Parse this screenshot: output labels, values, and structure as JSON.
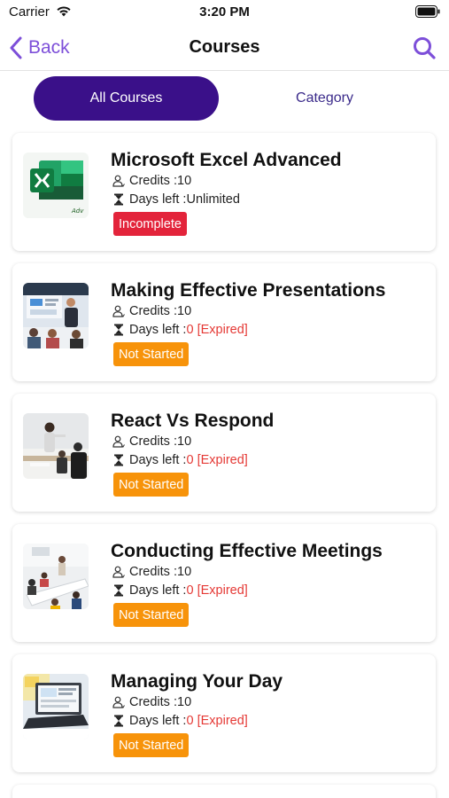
{
  "status_bar": {
    "carrier": "Carrier",
    "time": "3:20 PM"
  },
  "nav": {
    "back_label": "Back",
    "title": "Courses"
  },
  "tabs": {
    "all_courses": "All Courses",
    "category": "Category"
  },
  "labels": {
    "credits": "Credits : ",
    "days_left_unlimited": "Days left :",
    "days_left": "Days left : "
  },
  "colors": {
    "accent": "#7d4fd9",
    "tab_active": "#3a1089",
    "incomplete": "#e3243b",
    "not_started": "#f7930a",
    "expired": "#e53935"
  },
  "courses": [
    {
      "title": "Microsoft Excel Advanced",
      "credits": "10",
      "days_value": "Unlimited",
      "status": "Incomplete",
      "thumb_icon": "excel-logo-icon"
    },
    {
      "title": "Making Effective Presentations",
      "credits": "10",
      "days_value": "0",
      "expired_label": "[Expired]",
      "status": "Not Started",
      "thumb_icon": "presentation-photo"
    },
    {
      "title": "React Vs Respond",
      "credits": "10",
      "days_value": "0",
      "expired_label": "[Expired]",
      "status": "Not Started",
      "thumb_icon": "office-meeting-photo"
    },
    {
      "title": "Conducting Effective Meetings",
      "credits": "10",
      "days_value": "0",
      "expired_label": "[Expired]",
      "status": "Not Started",
      "thumb_icon": "conference-room-photo"
    },
    {
      "title": "Managing Your Day",
      "credits": "10",
      "days_value": "0",
      "expired_label": "[Expired]",
      "status": "Not Started",
      "thumb_icon": "laptop-desk-photo"
    }
  ]
}
